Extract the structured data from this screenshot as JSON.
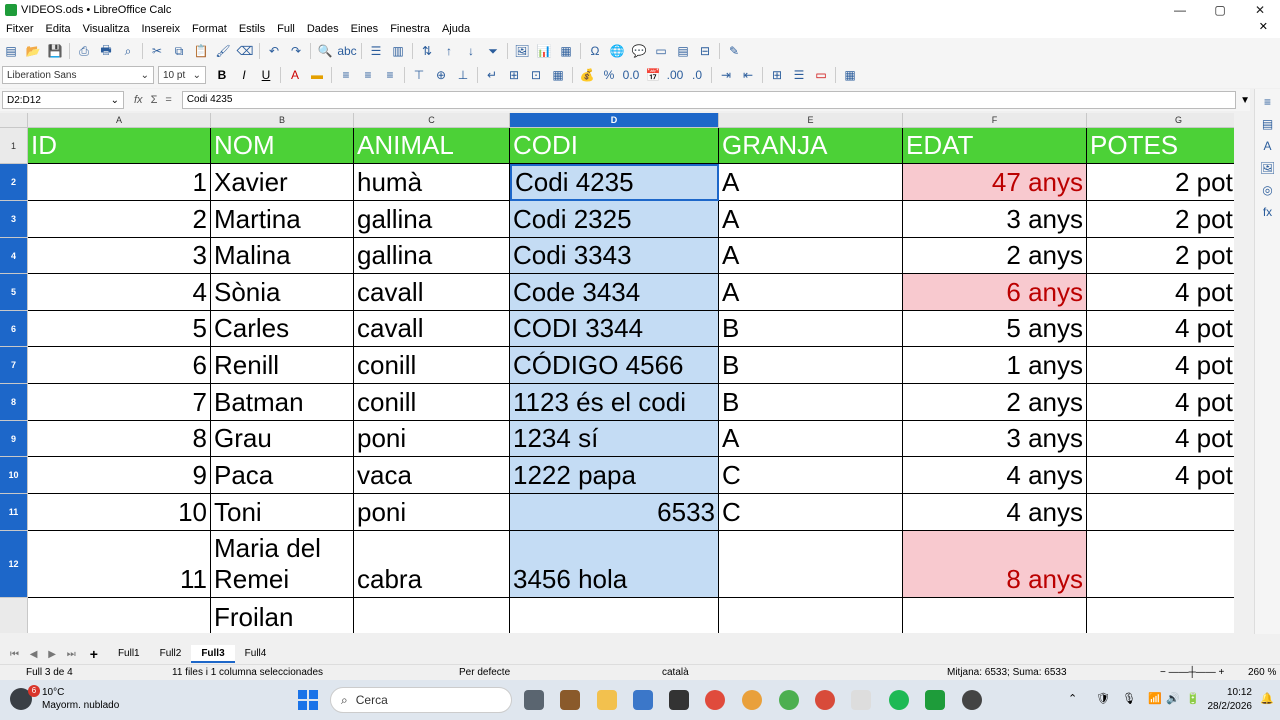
{
  "window": {
    "title": "VIDEOS.ods • LibreOffice Calc",
    "min": "—",
    "max": "▢",
    "close": "✕"
  },
  "menu": [
    "Fitxer",
    "Edita",
    "Visualitza",
    "Insereix",
    "Format",
    "Estils",
    "Full",
    "Dades",
    "Eines",
    "Finestra",
    "Ajuda"
  ],
  "format_bar": {
    "font_name": "Liberation Sans",
    "font_size": "10 pt"
  },
  "formula_bar": {
    "name_box": "D2:D12",
    "content": "Codi  4235"
  },
  "columns": [
    {
      "letter": "A",
      "header": "ID"
    },
    {
      "letter": "B",
      "header": "NOM"
    },
    {
      "letter": "C",
      "header": "ANIMAL"
    },
    {
      "letter": "D",
      "header": "CODI"
    },
    {
      "letter": "E",
      "header": "GRANJA"
    },
    {
      "letter": "F",
      "header": "EDAT"
    },
    {
      "letter": "G",
      "header": "POTES"
    }
  ],
  "rows": [
    {
      "num": "2",
      "id": "1",
      "nom": "Xavier",
      "animal": "humà",
      "codi": "Codi  4235",
      "granja": "A",
      "edat": "47 anys",
      "potes": "2 pot"
    },
    {
      "num": "3",
      "id": "2",
      "nom": "Martina",
      "animal": "gallina",
      "codi": "Codi 2325",
      "granja": "A",
      "edat": "3 anys",
      "potes": "2 pot"
    },
    {
      "num": "4",
      "id": "3",
      "nom": "Malina",
      "animal": "gallina",
      "codi": "Codi 3343",
      "granja": "A",
      "edat": "2 anys",
      "potes": "2 pot"
    },
    {
      "num": "5",
      "id": "4",
      "nom": "Sònia",
      "animal": "cavall",
      "codi": "Code 3434",
      "granja": "A",
      "edat": "6 anys",
      "potes": "4 pot"
    },
    {
      "num": "6",
      "id": "5",
      "nom": "Carles",
      "animal": "cavall",
      "codi": "CODI 3344",
      "granja": "B",
      "edat": "5 anys",
      "potes": "4 pot"
    },
    {
      "num": "7",
      "id": "6",
      "nom": "Renill",
      "animal": "conill",
      "codi": "CÓDIGO 4566",
      "granja": "B",
      "edat": "1 anys",
      "potes": "4 pot"
    },
    {
      "num": "8",
      "id": "7",
      "nom": "Batman",
      "animal": "conill",
      "codi": "1123 és el codi",
      "granja": "B",
      "edat": "2 anys",
      "potes": "4 pot"
    },
    {
      "num": "9",
      "id": "8",
      "nom": "Grau",
      "animal": "poni",
      "codi": "1234 sí",
      "granja": "A",
      "edat": "3 anys",
      "potes": "4 pot"
    },
    {
      "num": "10",
      "id": "9",
      "nom": "Paca",
      "animal": "vaca",
      "codi": "1222 papa",
      "granja": "C",
      "edat": "4 anys",
      "potes": "4 pot"
    },
    {
      "num": "11",
      "id": "10",
      "nom": "Toni",
      "animal": "poni",
      "codi": "6533",
      "granja": "C",
      "edat": "4 anys",
      "potes": ""
    },
    {
      "num": "12",
      "id": "11",
      "nom": "Maria del Remei",
      "animal": "cabra",
      "codi": "3456 hola",
      "granja": "",
      "edat": "8 anys",
      "potes": ""
    },
    {
      "num": "",
      "id": "",
      "nom": "Froilan",
      "animal": "",
      "codi": "",
      "granja": "",
      "edat": "",
      "potes": ""
    }
  ],
  "sheets": [
    "Full1",
    "Full2",
    "Full3",
    "Full4"
  ],
  "active_sheet": "Full3",
  "status": {
    "sheet_pos": "Full 3 de 4",
    "selection": "11 files i 1 columna seleccionades",
    "style": "Per defecte",
    "language": "català",
    "sum": "Mitjana: 6533; Suma: 6533",
    "zoom": "260 %"
  },
  "taskbar": {
    "temp": "10°C",
    "weather": "Mayorm. nublado",
    "badge": "6",
    "search": "Cerca",
    "time": "10:12",
    "date": "28/2/2026"
  },
  "colors": {
    "header_green": "#4cd137",
    "selection_blue": "#c4dcf4",
    "pink": "#f8c9cf"
  }
}
